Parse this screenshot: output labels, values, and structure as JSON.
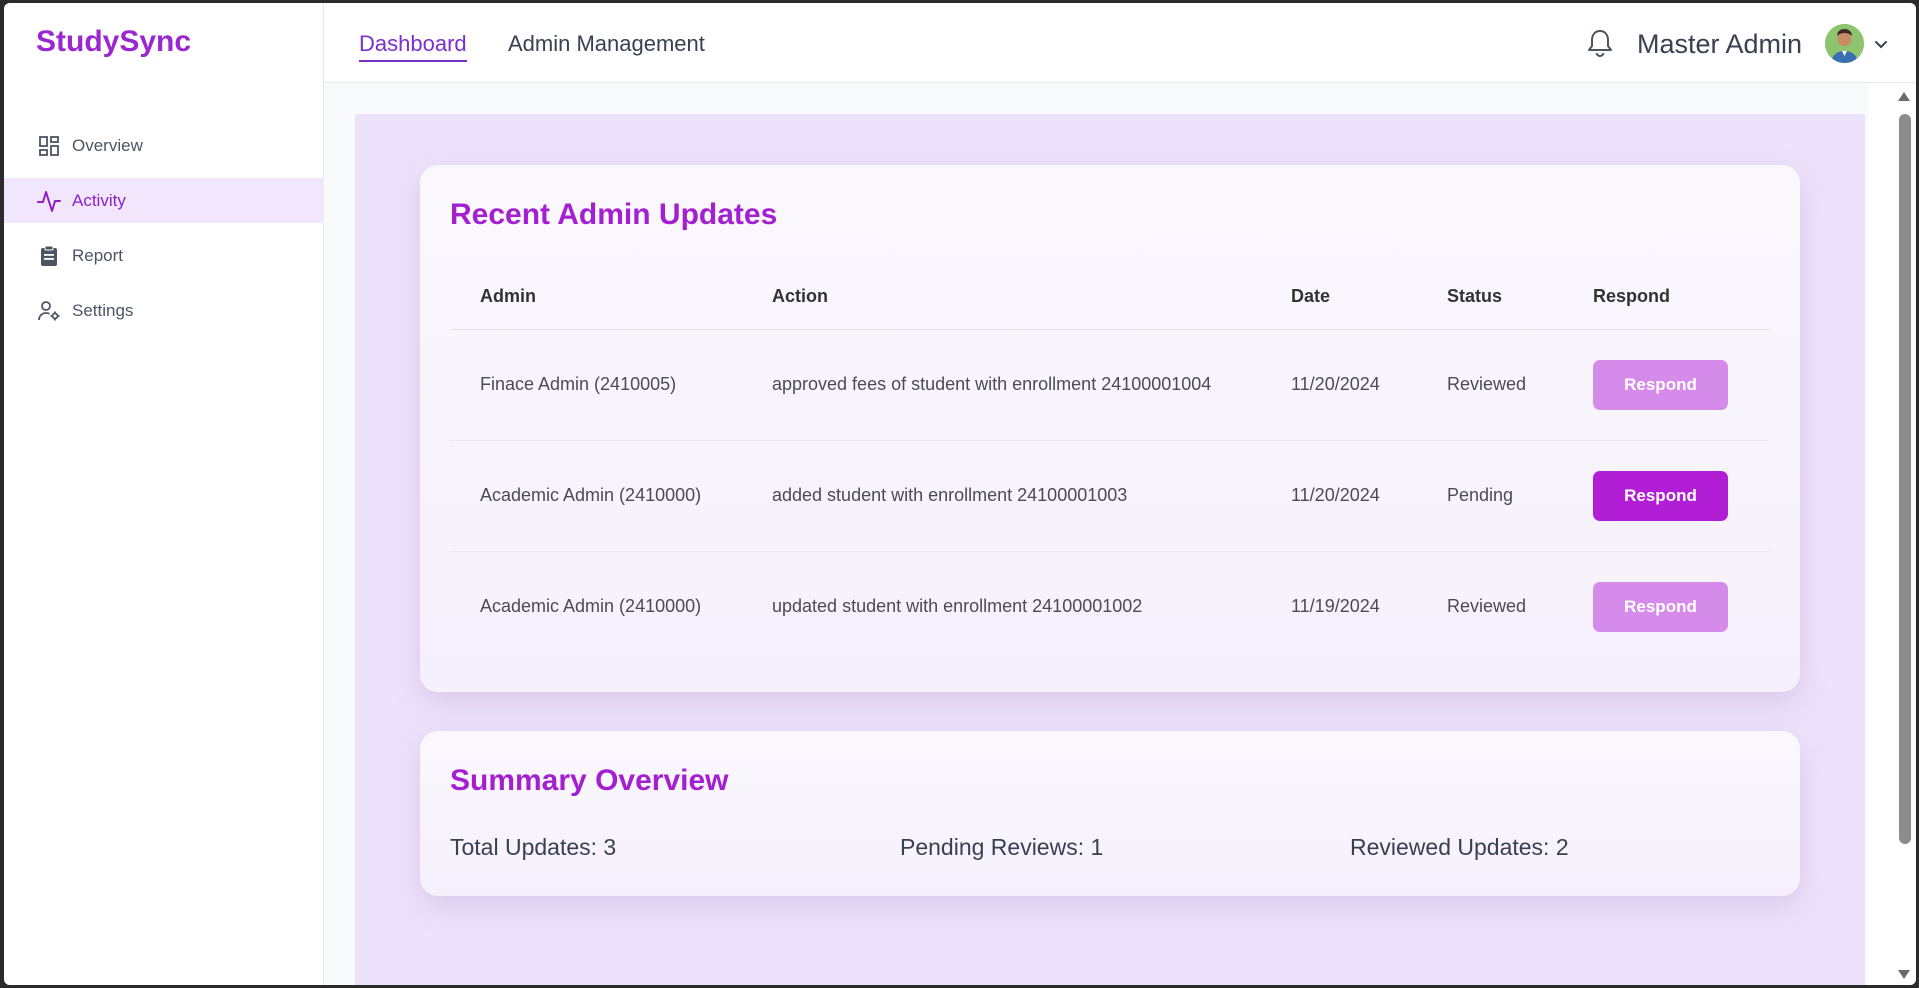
{
  "brand": "StudySync",
  "sidebar": {
    "items": [
      {
        "label": "Overview",
        "icon": "dashboard-grid-icon",
        "active": false
      },
      {
        "label": "Activity",
        "icon": "activity-pulse-icon",
        "active": true
      },
      {
        "label": "Report",
        "icon": "clipboard-icon",
        "active": false
      },
      {
        "label": "Settings",
        "icon": "user-gear-icon",
        "active": false
      }
    ]
  },
  "header": {
    "tabs": [
      {
        "label": "Dashboard",
        "active": true
      },
      {
        "label": "Admin Management",
        "active": false
      }
    ],
    "user_name": "Master Admin"
  },
  "updates": {
    "title": "Recent Admin Updates",
    "columns": [
      "Admin",
      "Action",
      "Date",
      "Status",
      "Respond"
    ],
    "rows": [
      {
        "admin": "Finace Admin (2410005)",
        "action": "approved fees of student with enrollment 24100001004",
        "date": "11/20/2024",
        "status": "Reviewed",
        "button": "Respond"
      },
      {
        "admin": "Academic Admin (2410000)",
        "action": "added student with enrollment 24100001003",
        "date": "11/20/2024",
        "status": "Pending",
        "button": "Respond"
      },
      {
        "admin": "Academic Admin (2410000)",
        "action": "updated student with enrollment 24100001002",
        "date": "11/19/2024",
        "status": "Reviewed",
        "button": "Respond"
      }
    ]
  },
  "summary": {
    "title": "Summary Overview",
    "total": "Total Updates: 3",
    "pending": "Pending Reviews: 1",
    "reviewed": "Reviewed Updates: 2"
  },
  "colors": {
    "brand": "#9b27d1",
    "active_bg": "#f2e6fd",
    "button_active": "#b21ed6",
    "button_muted": "#d58bea",
    "panel_bg": "#ede2fb"
  }
}
